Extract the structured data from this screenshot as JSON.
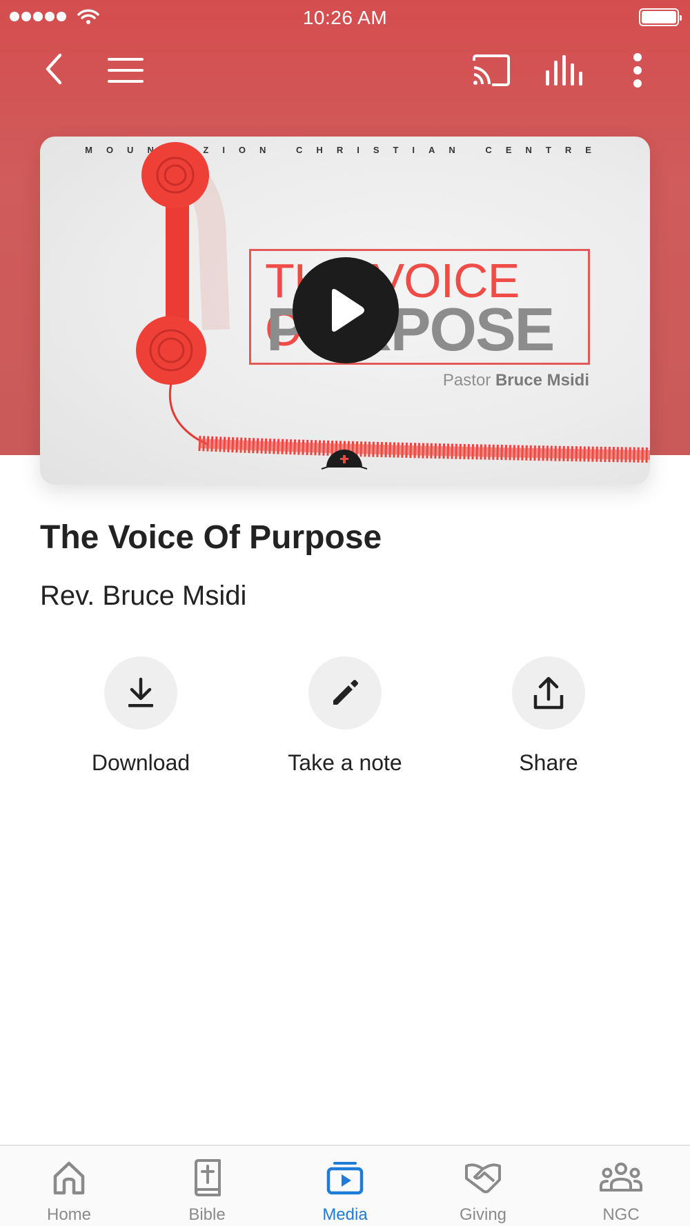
{
  "status_bar": {
    "time": "10:26 AM"
  },
  "artwork": {
    "church_name": "MOUNT ZION CHRISTIAN CENTRE",
    "title_line1": "THE VOICE OF",
    "title_line2": "PURPOSE",
    "pastor_prefix": "Pastor",
    "pastor_name": "Bruce Msidi"
  },
  "sermon": {
    "title": "The Voice Of Purpose",
    "speaker": "Rev. Bruce Msidi"
  },
  "actions": [
    {
      "label": "Download",
      "icon": "download-icon"
    },
    {
      "label": "Take a note",
      "icon": "pencil-icon"
    },
    {
      "label": "Share",
      "icon": "share-icon"
    }
  ],
  "tabs": [
    {
      "label": "Home",
      "icon": "home-icon"
    },
    {
      "label": "Bible",
      "icon": "bible-icon"
    },
    {
      "label": "Media",
      "icon": "media-icon",
      "active": true
    },
    {
      "label": "Giving",
      "icon": "giving-icon"
    },
    {
      "label": "NGC",
      "icon": "group-icon"
    }
  ],
  "colors": {
    "header": "#d3514f",
    "accent_active": "#1f7bd8",
    "inactive": "#8a8a8a"
  }
}
